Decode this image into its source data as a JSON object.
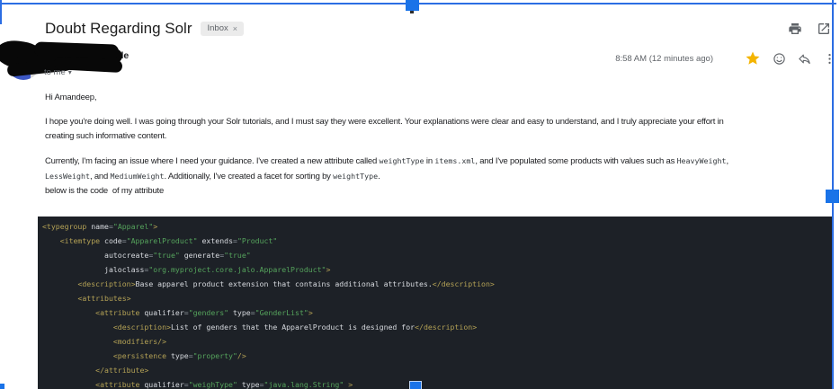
{
  "header": {
    "subject": "Doubt Regarding Solr",
    "label": "Inbox",
    "label_close": "×",
    "icons": [
      "print-icon",
      "open-in-new-icon"
    ]
  },
  "sender": {
    "name_visible_suffix": "de",
    "to_line": "to me",
    "timestamp": "8:58 AM (12 minutes ago)",
    "icons": [
      "star-icon",
      "emoji-reaction-icon",
      "reply-icon",
      "more-vert-icon"
    ],
    "star_color": "#f4b400",
    "icon_color": "#5f6368"
  },
  "annotation": {
    "color": "#1a73e8"
  },
  "body": {
    "paragraphs": [
      {
        "lines": [
          [
            {
              "t": "Hi Amandeep,"
            }
          ]
        ]
      },
      {
        "lines": [
          [
            {
              "t": "I hope you're doing well. I was going through your Solr tutorials, and I must say they were excellent. Your explanations were clear and easy to understand, and I truly appreciate your effort in"
            }
          ],
          [
            {
              "t": "creating such informative content."
            }
          ]
        ]
      },
      {
        "lines": [
          [
            {
              "t": "Currently, I'm facing an issue where I need your guidance. I've created a new attribute called "
            },
            {
              "c": "weightType"
            },
            {
              "t": " in "
            },
            {
              "c": "items.xml"
            },
            {
              "t": ", and I've populated some products with values such as "
            },
            {
              "c": "HeavyWeight"
            },
            {
              "t": ","
            }
          ],
          [
            {
              "c": "LessWeight"
            },
            {
              "t": ", and "
            },
            {
              "c": "MediumWeight"
            },
            {
              "t": ". Additionally, I've created a facet for sorting by "
            },
            {
              "c": "weightType"
            },
            {
              "t": "."
            }
          ],
          [
            {
              "t": "below is the code  of my attribute"
            }
          ]
        ]
      }
    ]
  },
  "code_block": {
    "colors": {
      "background": "#1d2127",
      "tag": "#b3a155",
      "string": "#55a35c",
      "equals": "#8f969f",
      "text": "#d6d9de"
    },
    "lines": [
      "<typegroup name=\"Apparel\">",
      "    <itemtype code=\"ApparelProduct\" extends=\"Product\"",
      "              autocreate=\"true\" generate=\"true\"",
      "              jaloclass=\"org.myproject.core.jalo.ApparelProduct\">",
      "        <description>Base apparel product extension that contains additional attributes.</description>",
      "        <attributes>",
      "            <attribute qualifier=\"genders\" type=\"GenderList\">",
      "                <description>List of genders that the ApparelProduct is designed for</description>",
      "                <modifiers/>",
      "                <persistence type=\"property\"/>",
      "            </attribute>",
      "            <attribute qualifier=\"weighType\" type=\"java.lang.String\" >"
    ]
  }
}
